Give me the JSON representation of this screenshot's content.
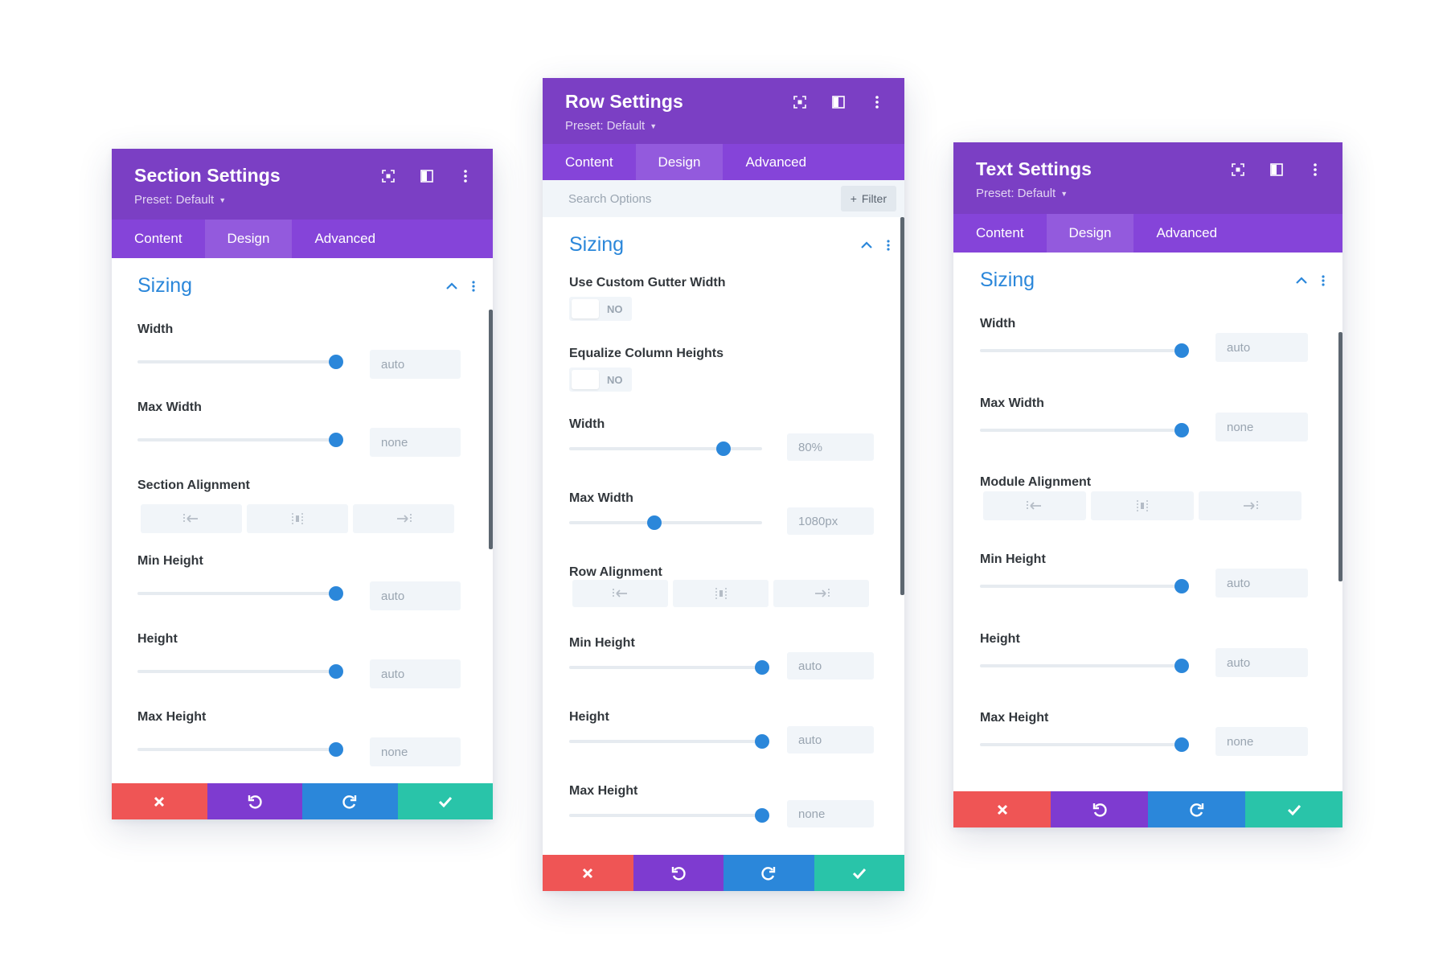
{
  "colors": {
    "header": "#7b3fc4",
    "tabs": "#8544d9",
    "accent": "#2b87da",
    "discard": "#ef5555",
    "undo": "#7e3bd0",
    "redo": "#2b87da",
    "save": "#29c4a9"
  },
  "panels": [
    {
      "title": "Section Settings",
      "preset": "Preset: Default",
      "tabs": [
        "Content",
        "Design",
        "Advanced"
      ],
      "active_tab": "Design",
      "group": "Sizing",
      "fields": [
        {
          "label": "Width",
          "type": "slider",
          "value": "auto",
          "level": 1.0
        },
        {
          "label": "Max Width",
          "type": "slider",
          "value": "none",
          "level": 1.0
        },
        {
          "label": "Section Alignment",
          "type": "align"
        },
        {
          "label": "Min Height",
          "type": "slider",
          "value": "auto",
          "level": 1.0
        },
        {
          "label": "Height",
          "type": "slider",
          "value": "auto",
          "level": 1.0
        },
        {
          "label": "Max Height",
          "type": "slider",
          "value": "none",
          "level": 1.0
        }
      ]
    },
    {
      "title": "Row Settings",
      "preset": "Preset: Default",
      "tabs": [
        "Content",
        "Design",
        "Advanced"
      ],
      "active_tab": "Design",
      "search_placeholder": "Search Options",
      "filter_label": "Filter",
      "group": "Sizing",
      "fields": [
        {
          "label": "Use Custom Gutter Width",
          "type": "toggle",
          "value": "NO"
        },
        {
          "label": "Equalize Column Heights",
          "type": "toggle",
          "value": "NO"
        },
        {
          "label": "Width",
          "type": "slider",
          "value": "80%",
          "level": 0.8
        },
        {
          "label": "Max Width",
          "type": "slider",
          "value": "1080px",
          "level": 0.44
        },
        {
          "label": "Row Alignment",
          "type": "align"
        },
        {
          "label": "Min Height",
          "type": "slider",
          "value": "auto",
          "level": 1.0
        },
        {
          "label": "Height",
          "type": "slider",
          "value": "auto",
          "level": 1.0
        },
        {
          "label": "Max Height",
          "type": "slider",
          "value": "none",
          "level": 1.0
        }
      ]
    },
    {
      "title": "Text Settings",
      "preset": "Preset: Default",
      "tabs": [
        "Content",
        "Design",
        "Advanced"
      ],
      "active_tab": "Design",
      "group": "Sizing",
      "fields": [
        {
          "label": "Width",
          "type": "slider",
          "value": "auto",
          "level": 1.0
        },
        {
          "label": "Max Width",
          "type": "slider",
          "value": "none",
          "level": 1.0
        },
        {
          "label": "Module Alignment",
          "type": "align"
        },
        {
          "label": "Min Height",
          "type": "slider",
          "value": "auto",
          "level": 1.0
        },
        {
          "label": "Height",
          "type": "slider",
          "value": "auto",
          "level": 1.0
        },
        {
          "label": "Max Height",
          "type": "slider",
          "value": "none",
          "level": 1.0
        }
      ]
    }
  ]
}
